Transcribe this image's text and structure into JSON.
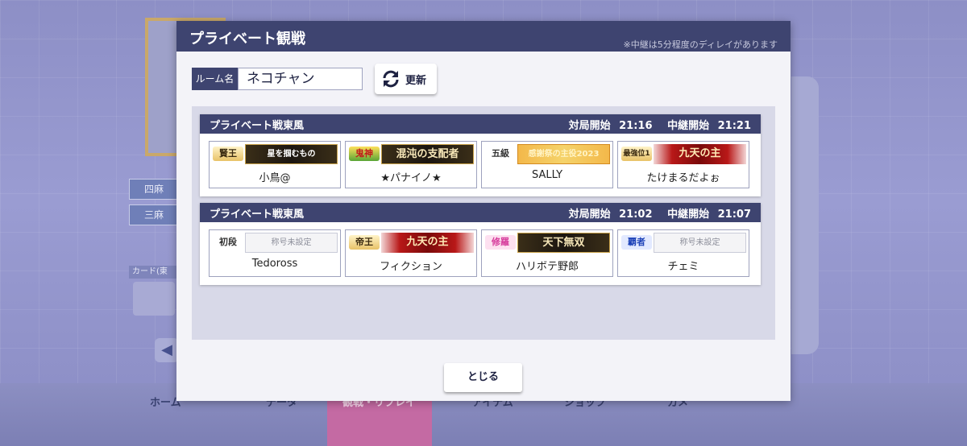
{
  "background": {
    "modes": [
      "四麻",
      "三麻"
    ],
    "card_label": "カード(東",
    "nav": [
      "ホーム",
      "データ",
      "観戦・リプレイ",
      "アイテム",
      "ショップ",
      "カメ"
    ]
  },
  "modal": {
    "title": "プライベート観戦",
    "note": "※中継は5分程度のディレイがあります",
    "room_label": "ルーム名",
    "room_value": "ネコチャン",
    "refresh_label": "更新",
    "close_label": "とじる"
  },
  "matches": [
    {
      "name": "プライベート戦東風",
      "start_label": "対局開始",
      "start_time": "21:16",
      "relay_label": "中継開始",
      "relay_time": "21:21",
      "players": [
        {
          "rank": "賢王",
          "title": "星を掴むもの",
          "name": "小鳥@"
        },
        {
          "rank": "鬼神",
          "title": "混沌の支配者",
          "name": "★パナイノ★"
        },
        {
          "rank": "五級",
          "title": "感謝祭の主役2023",
          "name": "SALLY"
        },
        {
          "rank": "最強位1",
          "title": "九天の主",
          "name": "たけまるだよぉ"
        }
      ]
    },
    {
      "name": "プライベート戦東風",
      "start_label": "対局開始",
      "start_time": "21:02",
      "relay_label": "中継開始",
      "relay_time": "21:07",
      "players": [
        {
          "rank": "初段",
          "title": "称号未設定",
          "name": "Tedoross"
        },
        {
          "rank": "帝王",
          "title": "九天の主",
          "name": "フィクション"
        },
        {
          "rank": "修羅",
          "title": "天下無双",
          "name": "ハリボテ野郎"
        },
        {
          "rank": "覇者",
          "title": "称号未設定",
          "name": "チェミ"
        }
      ]
    }
  ]
}
